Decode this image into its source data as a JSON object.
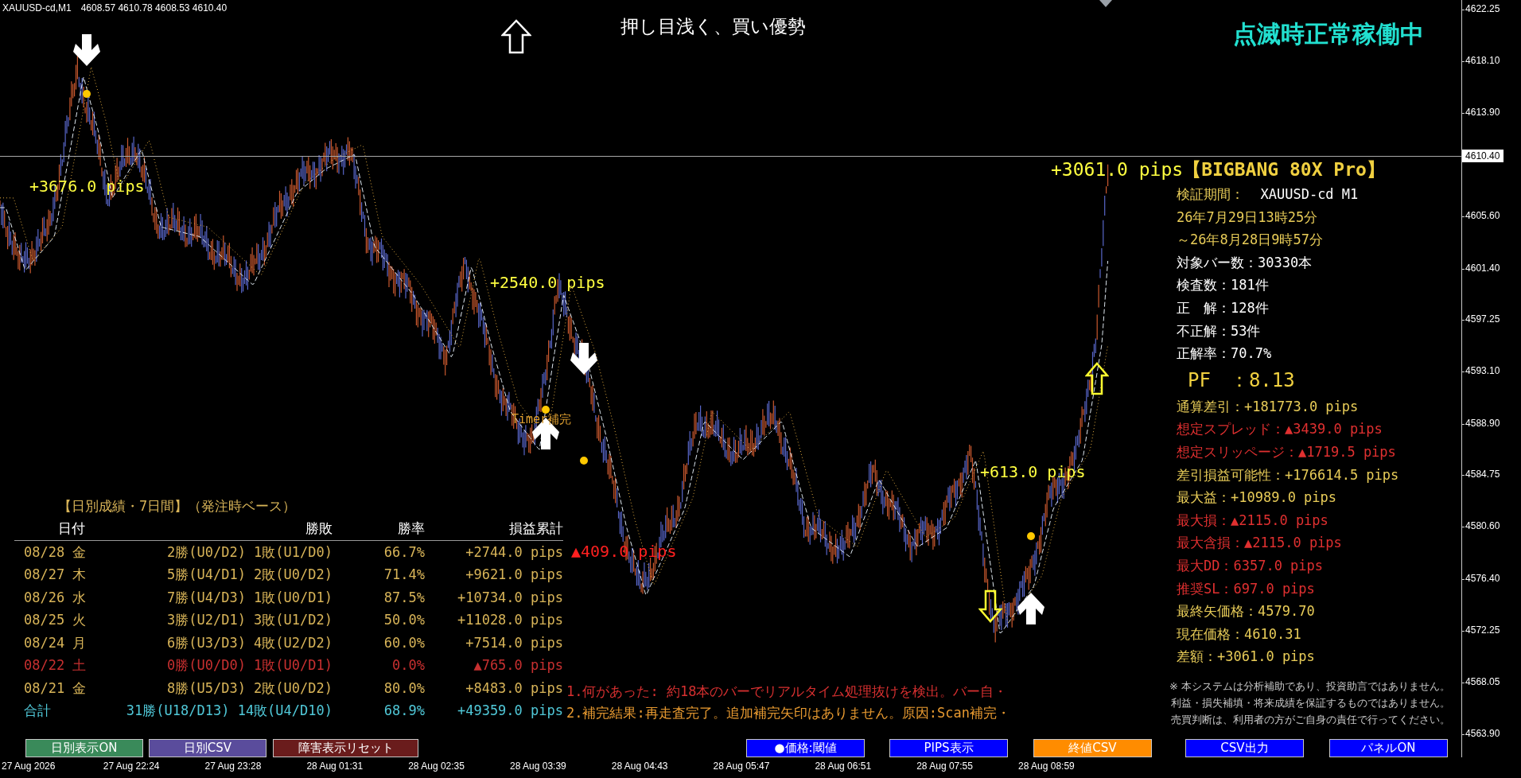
{
  "header": {
    "symbol": "XAUUSD-cd,M1",
    "quotes": "4608.57 4610.78 4608.53 4610.40"
  },
  "signal_title": "押し目浅く、買い優勢",
  "status": "点滅時正常稼働中",
  "chart_labels": [
    {
      "text": "+3676.0 pips",
      "kind": "profit"
    },
    {
      "text": "+2540.0 pips",
      "kind": "profit"
    },
    {
      "text": "Timer補完",
      "kind": "note"
    },
    {
      "text": "▲409.0 pips",
      "kind": "loss"
    },
    {
      "text": "+613.0 pips",
      "kind": "profit"
    }
  ],
  "panel": {
    "result": "+3061.0 pips",
    "title": "【BIGBANG 80X Pro】",
    "lines": [
      {
        "text": "検証期間：",
        "value": "XAUUSD-cd M1",
        "color": "#e8cc58",
        "kind": "stat"
      },
      {
        "text": "26年7月29日13時25分",
        "color": "#e8cc58",
        "kind": "stat"
      },
      {
        "text": "～26年8月28日9時57分",
        "color": "#e8cc58",
        "kind": "stat"
      },
      {
        "text": "対象バー数：30330本",
        "color": "#ffffff",
        "kind": "stat"
      },
      {
        "text": "検査数：181件",
        "color": "#ffffff",
        "kind": "stat"
      },
      {
        "text": "正　解：128件",
        "color": "#ffffff",
        "kind": "stat"
      },
      {
        "text": "不正解：53件",
        "color": "#ffffff",
        "kind": "stat"
      },
      {
        "text": "正解率：70.7%",
        "color": "#ffffff",
        "kind": "stat"
      },
      {
        "text": "PF　：8.13",
        "color": "#f0d040",
        "kind": "big"
      },
      {
        "text": "通算差引：+181773.0 pips",
        "color": "#e8cc58",
        "kind": "stat"
      },
      {
        "text": "想定スプレッド：▲3439.0 pips",
        "color": "#e03030",
        "kind": "stat"
      },
      {
        "text": "想定スリッページ：▲1719.5 pips",
        "color": "#e03030",
        "kind": "stat"
      },
      {
        "text": "差引損益可能性：+176614.5 pips",
        "color": "#e8cc58",
        "kind": "stat"
      },
      {
        "text": "最大益：+10989.0 pips",
        "color": "#e8cc58",
        "kind": "stat"
      },
      {
        "text": "最大損：▲2115.0 pips",
        "color": "#e03030",
        "kind": "stat"
      },
      {
        "text": "最大含損：▲2115.0 pips",
        "color": "#e03030",
        "kind": "stat"
      },
      {
        "text": "最大DD：6357.0 pips",
        "color": "#e03030",
        "kind": "stat"
      },
      {
        "text": "推奨SL：697.0 pips",
        "color": "#e03030",
        "kind": "stat"
      },
      {
        "text": "最終矢価格：4579.70",
        "color": "#e8cc58",
        "kind": "stat"
      },
      {
        "text": "現在価格：4610.31",
        "color": "#e8cc58",
        "kind": "stat"
      },
      {
        "text": "差額：+3061.0 pips",
        "color": "#e8cc58",
        "kind": "stat"
      }
    ],
    "disclaimer": [
      "※ 本システムは分析補助であり、投資助言ではありません。",
      "利益・損失補填・将来成績を保証するものではありません。",
      "売買判断は、利用者の方がご自身の責任で行ってください。"
    ]
  },
  "daily": {
    "title": "【日別成績・7日間】（発注時ベース）",
    "columns": [
      "日付",
      "勝敗",
      "勝率",
      "損益累計"
    ],
    "rows": [
      {
        "date": "08/28 金",
        "record": "2勝(U0/D2) 1敗(U1/D0)",
        "rate": "66.7%",
        "pnl": "+2744.0 pips",
        "color": "#d8b458"
      },
      {
        "date": "08/27 木",
        "record": "5勝(U4/D1) 2敗(U0/D2)",
        "rate": "71.4%",
        "pnl": "+9621.0 pips",
        "color": "#d8b458"
      },
      {
        "date": "08/26 水",
        "record": "7勝(U4/D3) 1敗(U0/D1)",
        "rate": "87.5%",
        "pnl": "+10734.0 pips",
        "color": "#d8b458"
      },
      {
        "date": "08/25 火",
        "record": "3勝(U2/D1) 3敗(U1/D2)",
        "rate": "50.0%",
        "pnl": "+11028.0 pips",
        "color": "#d8b458"
      },
      {
        "date": "08/24 月",
        "record": "6勝(U3/D3) 4敗(U2/D2)",
        "rate": "60.0%",
        "pnl": "+7514.0 pips",
        "color": "#d8b458"
      },
      {
        "date": "08/22 土",
        "record": "0勝(U0/D0) 1敗(U0/D1)",
        "rate": "0.0%",
        "pnl": "▲765.0 pips",
        "color": "#c83030"
      },
      {
        "date": "08/21 金",
        "record": "8勝(U5/D3) 2敗(U0/D2)",
        "rate": "80.0%",
        "pnl": "+8483.0 pips",
        "color": "#d8b458"
      },
      {
        "date": "合計",
        "record": "31勝(U18/D13) 14敗(U4/D10)",
        "rate": "68.9%",
        "pnl": "+49359.0 pips",
        "color": "#50c8d8"
      }
    ]
  },
  "messages": [
    {
      "text": "1.何があった: 約18本のバーでリアルタイム処理抜けを検出。バー自・",
      "color": "#d83030"
    },
    {
      "text": "2.補完結果:再走査完了。追加補完矢印はありません。原因:Scan補完・",
      "color": "#e89a30"
    }
  ],
  "buttons": [
    {
      "label": "日別表示ON",
      "color": "#3a8a5a"
    },
    {
      "label": "日別CSV",
      "color": "#5a4c9c"
    },
    {
      "label": "障害表示リセット",
      "color": "#6a1c1c"
    },
    {
      "label": "●価格:閾値",
      "color": "#0000ff"
    },
    {
      "label": "PIPS表示",
      "color": "#0000ff"
    },
    {
      "label": "終値CSV",
      "color": "#ff8c00"
    },
    {
      "label": "CSV出力",
      "color": "#0000ff"
    },
    {
      "label": "パネルON",
      "color": "#0000ff"
    }
  ],
  "current_price": "4610.40",
  "price_axis": [
    "4622.25",
    "4618.10",
    "4613.90",
    "4605.60",
    "4601.40",
    "4597.25",
    "4593.10",
    "4588.90",
    "4584.75",
    "4580.60",
    "4576.40",
    "4572.25",
    "4568.05",
    "4563.90"
  ],
  "time_axis": [
    "27 Aug 2026",
    "27 Aug 22:24",
    "27 Aug 23:28",
    "28 Aug 01:31",
    "28 Aug 02:35",
    "28 Aug 03:39",
    "28 Aug 04:43",
    "28 Aug 05:47",
    "28 Aug 06:51",
    "28 Aug 07:55",
    "28 Aug 08:59"
  ]
}
